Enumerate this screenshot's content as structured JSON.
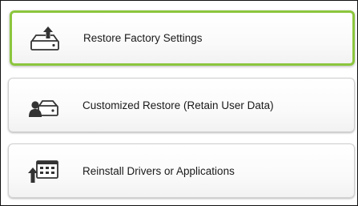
{
  "options": [
    {
      "label": "Restore Factory Settings",
      "icon": "drive-upload-icon",
      "selected": true,
      "accent": "#8cc63e"
    },
    {
      "label": "Customized Restore (Retain User Data)",
      "icon": "user-drive-icon",
      "selected": false
    },
    {
      "label": "Reinstall Drivers or Applications",
      "icon": "apps-grid-install-icon",
      "selected": false
    }
  ]
}
